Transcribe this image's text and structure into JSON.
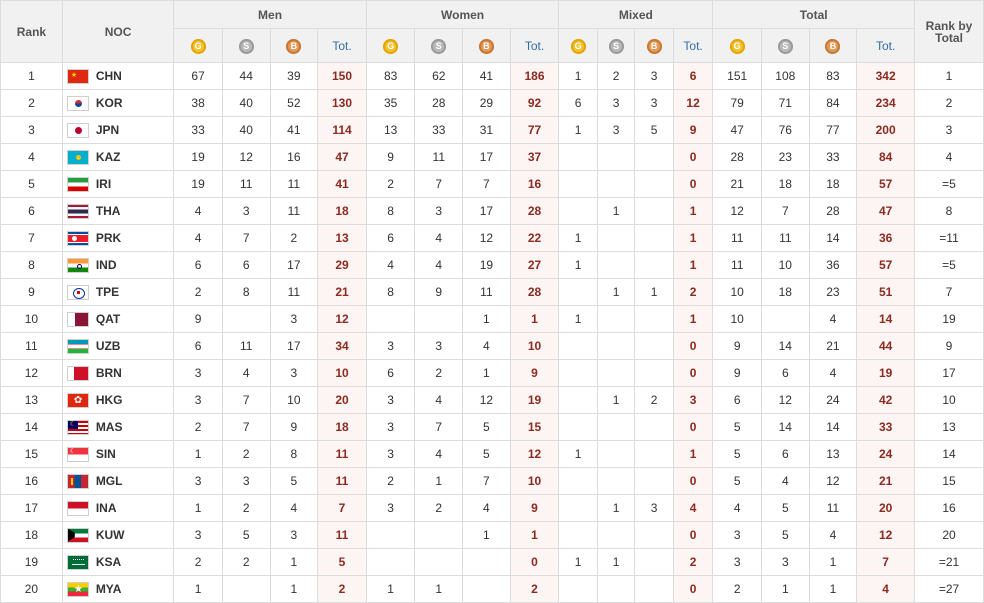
{
  "headers": {
    "rank": "Rank",
    "noc": "NOC",
    "men": "Men",
    "women": "Women",
    "mixed": "Mixed",
    "total": "Total",
    "rank_by_total": "Rank by Total",
    "tot": "Tot.",
    "gold_letter": "G",
    "silver_letter": "S",
    "bronze_letter": "B"
  },
  "colors": {
    "header_bg": "#f1f1f1",
    "border": "#dcdcdc",
    "total_cell_bg": "#fdf4f4",
    "total_text": "#8b2a1f",
    "tot_header_text": "#2f6ea6",
    "gold": "#f2c230",
    "silver": "#b9b9b9",
    "bronze": "#e29a56"
  },
  "rows": [
    {
      "rank": "1",
      "noc": "CHN",
      "flag": "flag-chn",
      "men": [
        "67",
        "44",
        "39",
        "150"
      ],
      "women": [
        "83",
        "62",
        "41",
        "186"
      ],
      "mixed": [
        "1",
        "2",
        "3",
        "6"
      ],
      "total": [
        "151",
        "108",
        "83",
        "342"
      ],
      "rank_total": "1"
    },
    {
      "rank": "2",
      "noc": "KOR",
      "flag": "flag-kor",
      "men": [
        "38",
        "40",
        "52",
        "130"
      ],
      "women": [
        "35",
        "28",
        "29",
        "92"
      ],
      "mixed": [
        "6",
        "3",
        "3",
        "12"
      ],
      "total": [
        "79",
        "71",
        "84",
        "234"
      ],
      "rank_total": "2"
    },
    {
      "rank": "3",
      "noc": "JPN",
      "flag": "flag-jpn",
      "men": [
        "33",
        "40",
        "41",
        "114"
      ],
      "women": [
        "13",
        "33",
        "31",
        "77"
      ],
      "mixed": [
        "1",
        "3",
        "5",
        "9"
      ],
      "total": [
        "47",
        "76",
        "77",
        "200"
      ],
      "rank_total": "3"
    },
    {
      "rank": "4",
      "noc": "KAZ",
      "flag": "flag-kaz",
      "men": [
        "19",
        "12",
        "16",
        "47"
      ],
      "women": [
        "9",
        "11",
        "17",
        "37"
      ],
      "mixed": [
        "",
        "",
        "",
        "0"
      ],
      "total": [
        "28",
        "23",
        "33",
        "84"
      ],
      "rank_total": "4"
    },
    {
      "rank": "5",
      "noc": "IRI",
      "flag": "flag-iri",
      "men": [
        "19",
        "11",
        "11",
        "41"
      ],
      "women": [
        "2",
        "7",
        "7",
        "16"
      ],
      "mixed": [
        "",
        "",
        "",
        "0"
      ],
      "total": [
        "21",
        "18",
        "18",
        "57"
      ],
      "rank_total": "=5"
    },
    {
      "rank": "6",
      "noc": "THA",
      "flag": "flag-tha",
      "men": [
        "4",
        "3",
        "11",
        "18"
      ],
      "women": [
        "8",
        "3",
        "17",
        "28"
      ],
      "mixed": [
        "",
        "1",
        "",
        "1"
      ],
      "total": [
        "12",
        "7",
        "28",
        "47"
      ],
      "rank_total": "8"
    },
    {
      "rank": "7",
      "noc": "PRK",
      "flag": "flag-prk",
      "men": [
        "4",
        "7",
        "2",
        "13"
      ],
      "women": [
        "6",
        "4",
        "12",
        "22"
      ],
      "mixed": [
        "1",
        "",
        "",
        "1"
      ],
      "total": [
        "11",
        "11",
        "14",
        "36"
      ],
      "rank_total": "=11"
    },
    {
      "rank": "8",
      "noc": "IND",
      "flag": "flag-ind",
      "men": [
        "6",
        "6",
        "17",
        "29"
      ],
      "women": [
        "4",
        "4",
        "19",
        "27"
      ],
      "mixed": [
        "1",
        "",
        "",
        "1"
      ],
      "total": [
        "11",
        "10",
        "36",
        "57"
      ],
      "rank_total": "=5"
    },
    {
      "rank": "9",
      "noc": "TPE",
      "flag": "flag-tpe",
      "men": [
        "2",
        "8",
        "11",
        "21"
      ],
      "women": [
        "8",
        "9",
        "11",
        "28"
      ],
      "mixed": [
        "",
        "1",
        "1",
        "2"
      ],
      "total": [
        "10",
        "18",
        "23",
        "51"
      ],
      "rank_total": "7"
    },
    {
      "rank": "10",
      "noc": "QAT",
      "flag": "flag-qat",
      "men": [
        "9",
        "",
        "3",
        "12"
      ],
      "women": [
        "",
        "",
        "1",
        "1"
      ],
      "mixed": [
        "1",
        "",
        "",
        "1"
      ],
      "total": [
        "10",
        "",
        "4",
        "14"
      ],
      "rank_total": "19"
    },
    {
      "rank": "11",
      "noc": "UZB",
      "flag": "flag-uzb",
      "men": [
        "6",
        "11",
        "17",
        "34"
      ],
      "women": [
        "3",
        "3",
        "4",
        "10"
      ],
      "mixed": [
        "",
        "",
        "",
        "0"
      ],
      "total": [
        "9",
        "14",
        "21",
        "44"
      ],
      "rank_total": "9"
    },
    {
      "rank": "12",
      "noc": "BRN",
      "flag": "flag-brn",
      "men": [
        "3",
        "4",
        "3",
        "10"
      ],
      "women": [
        "6",
        "2",
        "1",
        "9"
      ],
      "mixed": [
        "",
        "",
        "",
        "0"
      ],
      "total": [
        "9",
        "6",
        "4",
        "19"
      ],
      "rank_total": "17"
    },
    {
      "rank": "13",
      "noc": "HKG",
      "flag": "flag-hkg",
      "men": [
        "3",
        "7",
        "10",
        "20"
      ],
      "women": [
        "3",
        "4",
        "12",
        "19"
      ],
      "mixed": [
        "",
        "1",
        "2",
        "3"
      ],
      "total": [
        "6",
        "12",
        "24",
        "42"
      ],
      "rank_total": "10"
    },
    {
      "rank": "14",
      "noc": "MAS",
      "flag": "flag-mas",
      "men": [
        "2",
        "7",
        "9",
        "18"
      ],
      "women": [
        "3",
        "7",
        "5",
        "15"
      ],
      "mixed": [
        "",
        "",
        "",
        "0"
      ],
      "total": [
        "5",
        "14",
        "14",
        "33"
      ],
      "rank_total": "13"
    },
    {
      "rank": "15",
      "noc": "SIN",
      "flag": "flag-sin",
      "men": [
        "1",
        "2",
        "8",
        "11"
      ],
      "women": [
        "3",
        "4",
        "5",
        "12"
      ],
      "mixed": [
        "1",
        "",
        "",
        "1"
      ],
      "total": [
        "5",
        "6",
        "13",
        "24"
      ],
      "rank_total": "14"
    },
    {
      "rank": "16",
      "noc": "MGL",
      "flag": "flag-mgl",
      "men": [
        "3",
        "3",
        "5",
        "11"
      ],
      "women": [
        "2",
        "1",
        "7",
        "10"
      ],
      "mixed": [
        "",
        "",
        "",
        "0"
      ],
      "total": [
        "5",
        "4",
        "12",
        "21"
      ],
      "rank_total": "15"
    },
    {
      "rank": "17",
      "noc": "INA",
      "flag": "flag-ina",
      "men": [
        "1",
        "2",
        "4",
        "7"
      ],
      "women": [
        "3",
        "2",
        "4",
        "9"
      ],
      "mixed": [
        "",
        "1",
        "3",
        "4"
      ],
      "total": [
        "4",
        "5",
        "11",
        "20"
      ],
      "rank_total": "16"
    },
    {
      "rank": "18",
      "noc": "KUW",
      "flag": "flag-kuw",
      "men": [
        "3",
        "5",
        "3",
        "11"
      ],
      "women": [
        "",
        "",
        "1",
        "1"
      ],
      "mixed": [
        "",
        "",
        "",
        "0"
      ],
      "total": [
        "3",
        "5",
        "4",
        "12"
      ],
      "rank_total": "20"
    },
    {
      "rank": "19",
      "noc": "KSA",
      "flag": "flag-ksa",
      "men": [
        "2",
        "2",
        "1",
        "5"
      ],
      "women": [
        "",
        "",
        "",
        "0"
      ],
      "mixed": [
        "1",
        "1",
        "",
        "2"
      ],
      "total": [
        "3",
        "3",
        "1",
        "7"
      ],
      "rank_total": "=21"
    },
    {
      "rank": "20",
      "noc": "MYA",
      "flag": "flag-mya",
      "men": [
        "1",
        "",
        "1",
        "2"
      ],
      "women": [
        "1",
        "1",
        "",
        "2"
      ],
      "mixed": [
        "",
        "",
        "",
        "0"
      ],
      "total": [
        "2",
        "1",
        "1",
        "4"
      ],
      "rank_total": "=27"
    }
  ]
}
